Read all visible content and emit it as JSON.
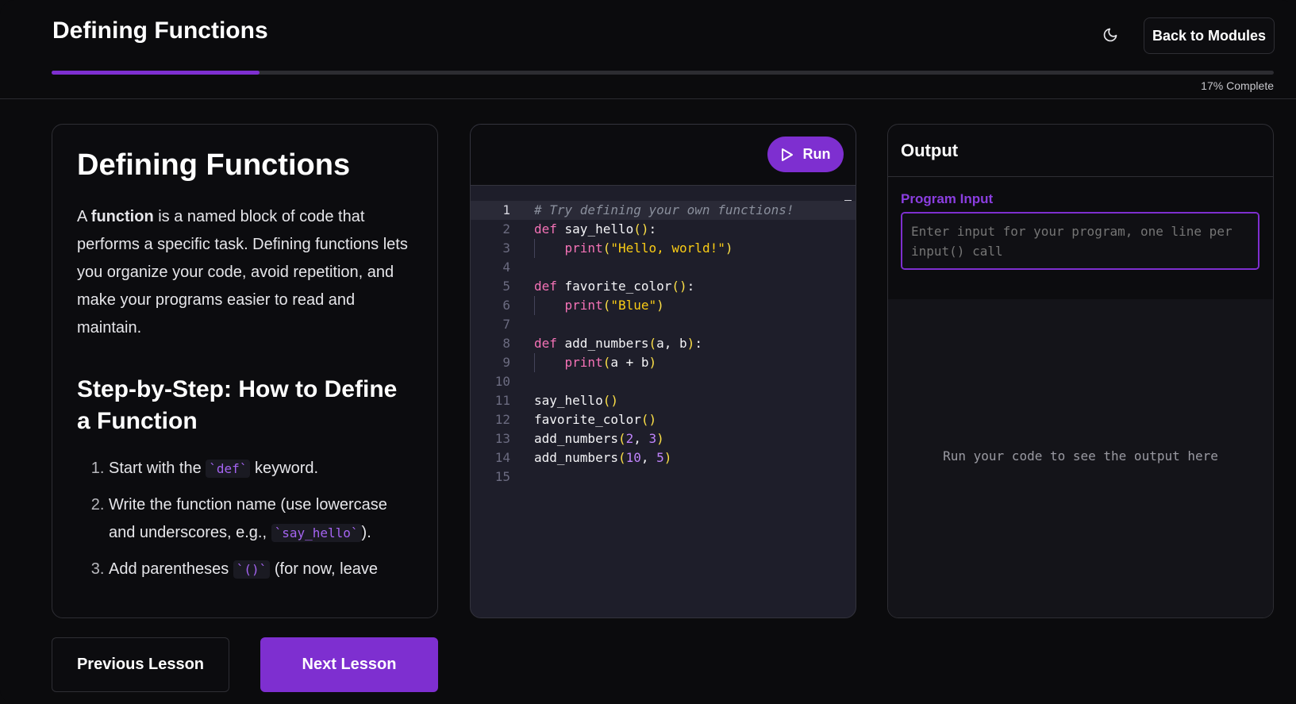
{
  "header": {
    "title": "Defining Functions",
    "theme_icon": "moon-icon",
    "back_label": "Back to Modules",
    "progress_fraction": 0.17,
    "progress_text": "17% Complete"
  },
  "lesson": {
    "heading": "Defining Functions",
    "intro_pre": "A ",
    "intro_bold": "function",
    "intro_post": " is a named block of code that performs a specific task. Defining functions lets you organize your code, avoid repetition, and make your programs easier to read and maintain.",
    "subheading": "Step-by-Step: How to Define a Function",
    "steps": [
      {
        "pre": "Start with the ",
        "code": "`def`",
        "post": " keyword."
      },
      {
        "pre": "Write the function name (use lowercase and underscores, e.g., ",
        "code": "`say_hello`",
        "post": ")."
      },
      {
        "pre": "Add parentheses ",
        "code": "`()`",
        "post": " (for now, leave"
      }
    ]
  },
  "editor": {
    "run_label": "Run",
    "run_icon": "play-icon",
    "line_numbers": [
      "1",
      "2",
      "3",
      "4",
      "5",
      "6",
      "7",
      "8",
      "9",
      "10",
      "11",
      "12",
      "13",
      "14",
      "15"
    ]
  },
  "colors": {
    "accent": "#7e2fd0",
    "keyword": "#f472b6",
    "string": "#facc15",
    "comment": "#8a8f9c"
  },
  "output": {
    "title": "Output",
    "input_label": "Program Input",
    "input_placeholder": "Enter input for your program, one line per input() call",
    "placeholder": "Run your code to see the output here"
  },
  "nav": {
    "previous_label": "Previous Lesson",
    "next_label": "Next Lesson"
  }
}
